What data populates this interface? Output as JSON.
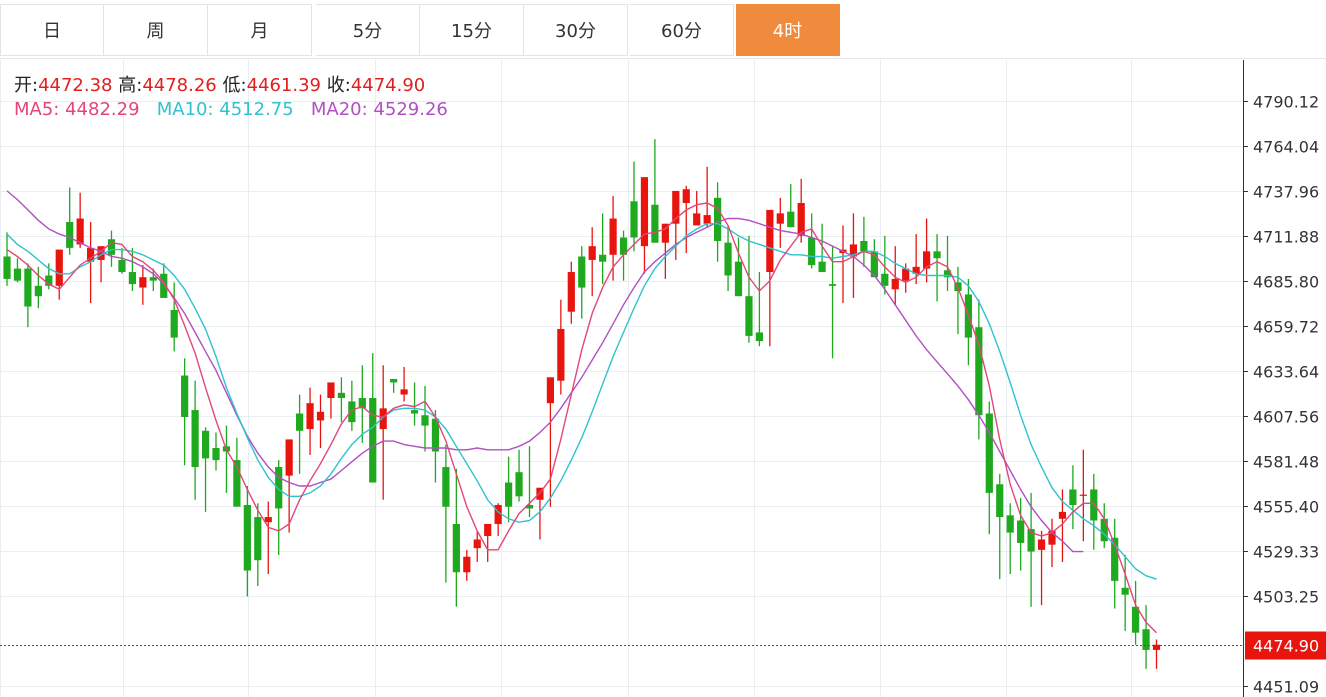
{
  "tabs": [
    {
      "label": "日",
      "active": false
    },
    {
      "label": "周",
      "active": false
    },
    {
      "label": "月",
      "active": false
    },
    {
      "label": "5分",
      "active": false
    },
    {
      "label": "15分",
      "active": false
    },
    {
      "label": "30分",
      "active": false
    },
    {
      "label": "60分",
      "active": false
    },
    {
      "label": "4时",
      "active": true
    }
  ],
  "ohlc_info": {
    "open_label": "开:",
    "open": "4472.38",
    "high_label": "高:",
    "high": "4478.26",
    "low_label": "低:",
    "low": "4461.39",
    "close_label": "收:",
    "close": "4474.90"
  },
  "ma_info": {
    "ma5_label": "MA5:",
    "ma5": "4482.29",
    "ma10_label": "MA10:",
    "ma10": "4512.75",
    "ma20_label": "MA20:",
    "ma20": "4529.26"
  },
  "colors": {
    "up": "#e8150f",
    "down": "#1ea91e",
    "ma5": "#e4467a",
    "ma10": "#2fc2cf",
    "ma20": "#b24fc4",
    "accent": "#f08a3c",
    "price_tag": "#e8150f"
  },
  "chart_data": {
    "type": "candlestick",
    "y_ticks": [
      "4790.12",
      "4764.04",
      "4737.96",
      "4711.88",
      "4685.80",
      "4659.72",
      "4633.64",
      "4607.56",
      "4581.48",
      "4555.40",
      "4529.33",
      "4503.25",
      "4451.09"
    ],
    "ylim": [
      4451.09,
      4790.12
    ],
    "current_price": "4474.90",
    "candles": [
      [
        4700,
        4714,
        4683,
        4687
      ],
      [
        4693,
        4699,
        4685,
        4686
      ],
      [
        4693,
        4696,
        4659,
        4671
      ],
      [
        4683,
        4694,
        4670,
        4677
      ],
      [
        4689,
        4696,
        4681,
        4683
      ],
      [
        4683,
        4693,
        4675,
        4704
      ],
      [
        4720,
        4740,
        4701,
        4705
      ],
      [
        4707,
        4737,
        4705,
        4722
      ],
      [
        4697,
        4720,
        4673,
        4705
      ],
      [
        4698,
        4705,
        4685,
        4706
      ],
      [
        4710,
        4715,
        4694,
        4701
      ],
      [
        4698,
        4705,
        4690,
        4691
      ],
      [
        4691,
        4705,
        4680,
        4684
      ],
      [
        4682,
        4695,
        4672,
        4688
      ],
      [
        4688,
        4693,
        4680,
        4686
      ],
      [
        4690,
        4696,
        4677,
        4676
      ],
      [
        4669,
        4685,
        4645,
        4653
      ],
      [
        4631,
        4641,
        4579,
        4607
      ],
      [
        4611,
        4628,
        4559,
        4578
      ],
      [
        4599,
        4601,
        4552,
        4583
      ],
      [
        4589,
        4598,
        4576,
        4582
      ],
      [
        4590,
        4602,
        4563,
        4587
      ],
      [
        4582,
        4595,
        4565,
        4555
      ],
      [
        4556,
        4567,
        4503,
        4518
      ],
      [
        4549,
        4557,
        4509,
        4524
      ],
      [
        4546,
        4558,
        4516,
        4549
      ],
      [
        4578,
        4582,
        4527,
        4554
      ],
      [
        4573,
        4582,
        4540,
        4594
      ],
      [
        4609,
        4620,
        4574,
        4599
      ],
      [
        4600,
        4624,
        4585,
        4615
      ],
      [
        4605,
        4620,
        4589,
        4610
      ],
      [
        4618,
        4626,
        4606,
        4627
      ],
      [
        4621,
        4630,
        4604,
        4618
      ],
      [
        4616,
        4628,
        4599,
        4604
      ],
      [
        4618,
        4637,
        4592,
        4612
      ],
      [
        4618,
        4644,
        4594,
        4569
      ],
      [
        4600,
        4637,
        4559,
        4612
      ],
      [
        4629,
        4627,
        4621,
        4627
      ],
      [
        4620,
        4636,
        4616,
        4623
      ],
      [
        4611,
        4627,
        4602,
        4609
      ],
      [
        4608,
        4625,
        4587,
        4602
      ],
      [
        4606,
        4611,
        4569,
        4587
      ],
      [
        4578,
        4591,
        4511,
        4555
      ],
      [
        4545,
        4577,
        4497,
        4517
      ],
      [
        4517,
        4530,
        4512,
        4526
      ],
      [
        4531,
        4541,
        4523,
        4536
      ],
      [
        4538,
        4544,
        4523,
        4545
      ],
      [
        4545,
        4557,
        4538,
        4556
      ],
      [
        4569,
        4584,
        4546,
        4555
      ],
      [
        4575,
        4588,
        4558,
        4561
      ],
      [
        4556,
        4590,
        4549,
        4554
      ],
      [
        4559,
        4565,
        4536,
        4566
      ],
      [
        4615,
        4618,
        4555,
        4630
      ],
      [
        4628,
        4675,
        4620,
        4658
      ],
      [
        4668,
        4697,
        4661,
        4691
      ],
      [
        4700,
        4706,
        4664,
        4682
      ],
      [
        4698,
        4717,
        4677,
        4706
      ],
      [
        4701,
        4725,
        4684,
        4697
      ],
      [
        4701,
        4735,
        4686,
        4722
      ],
      [
        4711,
        4715,
        4686,
        4701
      ],
      [
        4732,
        4755,
        4703,
        4711
      ],
      [
        4706,
        4741,
        4690,
        4746
      ],
      [
        4730,
        4768,
        4711,
        4708
      ],
      [
        4708,
        4719,
        4687,
        4719
      ],
      [
        4719,
        4737,
        4698,
        4738
      ],
      [
        4731,
        4741,
        4702,
        4739
      ],
      [
        4718,
        4738,
        4719,
        4725
      ],
      [
        4719,
        4752,
        4717,
        4724
      ],
      [
        4734,
        4743,
        4697,
        4709
      ],
      [
        4708,
        4718,
        4680,
        4689
      ],
      [
        4697,
        4711,
        4685,
        4677
      ],
      [
        4677,
        4712,
        4650,
        4654
      ],
      [
        4656,
        4691,
        4648,
        4651
      ],
      [
        4691,
        4718,
        4648,
        4727
      ],
      [
        4719,
        4734,
        4705,
        4725
      ],
      [
        4726,
        4742,
        4717,
        4717
      ],
      [
        4712,
        4745,
        4708,
        4731
      ],
      [
        4711,
        4725,
        4693,
        4695
      ],
      [
        4697,
        4719,
        4691,
        4691
      ],
      [
        4684,
        4706,
        4641,
        4683
      ],
      [
        4702,
        4718,
        4673,
        4704
      ],
      [
        4700,
        4725,
        4676,
        4707
      ],
      [
        4709,
        4723,
        4694,
        4703
      ],
      [
        4703,
        4710,
        4694,
        4688
      ],
      [
        4690,
        4712,
        4678,
        4683
      ],
      [
        4681,
        4706,
        4672,
        4687
      ],
      [
        4686,
        4696,
        4679,
        4693
      ],
      [
        4690,
        4713,
        4684,
        4694
      ],
      [
        4693,
        4722,
        4685,
        4703
      ],
      [
        4703,
        4713,
        4674,
        4699
      ],
      [
        4692,
        4712,
        4680,
        4688
      ],
      [
        4685,
        4694,
        4655,
        4680
      ],
      [
        4678,
        4687,
        4637,
        4653
      ],
      [
        4659,
        4675,
        4594,
        4608
      ],
      [
        4609,
        4616,
        4539,
        4563
      ],
      [
        4568,
        4574,
        4513,
        4549
      ],
      [
        4550,
        4557,
        4516,
        4540
      ],
      [
        4547,
        4560,
        4518,
        4534
      ],
      [
        4542,
        4563,
        4497,
        4529
      ],
      [
        4530,
        4541,
        4498,
        4536
      ],
      [
        4533,
        4548,
        4520,
        4541
      ],
      [
        4548,
        4565,
        4523,
        4552
      ],
      [
        4565,
        4579,
        4542,
        4556
      ],
      [
        4562,
        4588,
        4535,
        4562
      ],
      [
        4565,
        4574,
        4530,
        4547
      ],
      [
        4548,
        4557,
        4531,
        4535
      ],
      [
        4537,
        4548,
        4496,
        4512
      ],
      [
        4508,
        4527,
        4483,
        4504
      ],
      [
        4497,
        4512,
        4475,
        4482
      ],
      [
        4484,
        4498,
        4461,
        4472
      ],
      [
        4472,
        4478,
        4461,
        4475
      ]
    ],
    "ma5": [
      4704,
      4700,
      4695,
      4689,
      4684,
      4681,
      4688,
      4695,
      4699,
      4703,
      4708,
      4707,
      4700,
      4697,
      4692,
      4685,
      4675,
      4660,
      4644,
      4624,
      4605,
      4588,
      4578,
      4565,
      4553,
      4543,
      4541,
      4545,
      4559,
      4570,
      4580,
      4591,
      4603,
      4611,
      4613,
      4608,
      4607,
      4612,
      4614,
      4613,
      4616,
      4607,
      4593,
      4574,
      4555,
      4541,
      4530,
      4530,
      4541,
      4551,
      4557,
      4563,
      4571,
      4594,
      4620,
      4646,
      4667,
      4682,
      4694,
      4701,
      4707,
      4713,
      4714,
      4716,
      4722,
      4727,
      4730,
      4731,
      4728,
      4718,
      4702,
      4688,
      4680,
      4686,
      4698,
      4706,
      4714,
      4716,
      4706,
      4697,
      4697,
      4700,
      4703,
      4701,
      4694,
      4688,
      4685,
      4688,
      4694,
      4697,
      4694,
      4682,
      4666,
      4649,
      4625,
      4594,
      4568,
      4550,
      4540,
      4538,
      4540,
      4545,
      4552,
      4557,
      4557,
      4548,
      4533,
      4516,
      4498,
      4488,
      4482
    ],
    "ma10": [
      4713,
      4707,
      4703,
      4698,
      4693,
      4690,
      4690,
      4694,
      4697,
      4701,
      4704,
      4704,
      4703,
      4701,
      4698,
      4695,
      4689,
      4681,
      4670,
      4658,
      4642,
      4624,
      4609,
      4595,
      4582,
      4572,
      4565,
      4561,
      4561,
      4563,
      4567,
      4574,
      4583,
      4591,
      4597,
      4601,
      4607,
      4611,
      4612,
      4612,
      4611,
      4607,
      4600,
      4590,
      4580,
      4570,
      4559,
      4552,
      4548,
      4546,
      4547,
      4552,
      4560,
      4570,
      4582,
      4595,
      4610,
      4626,
      4642,
      4656,
      4670,
      4683,
      4693,
      4700,
      4706,
      4712,
      4716,
      4719,
      4719,
      4716,
      4712,
      4709,
      4707,
      4705,
      4703,
      4701,
      4701,
      4700,
      4700,
      4699,
      4700,
      4701,
      4703,
      4703,
      4700,
      4696,
      4693,
      4690,
      4689,
      4689,
      4689,
      4688,
      4683,
      4674,
      4661,
      4645,
      4627,
      4608,
      4591,
      4578,
      4566,
      4558,
      4553,
      4548,
      4544,
      4539,
      4533,
      4526,
      4519,
      4515,
      4513
    ],
    "ma20": [
      4738,
      4733,
      4727,
      4721,
      4716,
      4713,
      4711,
      4708,
      4705,
      4703,
      4700,
      4699,
      4697,
      4694,
      4690,
      4684,
      4676,
      4667,
      4656,
      4645,
      4634,
      4621,
      4608,
      4596,
      4586,
      4578,
      4572,
      4569,
      4567,
      4567,
      4569,
      4571,
      4576,
      4581,
      4586,
      4590,
      4593,
      4593,
      4591,
      4590,
      4589,
      4589,
      4589,
      4588,
      4588,
      4589,
      4588,
      4588,
      4588,
      4590,
      4593,
      4598,
      4604,
      4612,
      4621,
      4630,
      4640,
      4650,
      4661,
      4672,
      4682,
      4691,
      4697,
      4702,
      4707,
      4711,
      4714,
      4717,
      4720,
      4722,
      4722,
      4721,
      4719,
      4717,
      4715,
      4714,
      4713,
      4711,
      4709,
      4706,
      4703,
      4700,
      4695,
      4689,
      4681,
      4672,
      4663,
      4654,
      4646,
      4639,
      4632,
      4625,
      4617,
      4608,
      4598,
      4587,
      4576,
      4565,
      4555,
      4547,
      4540,
      4535,
      4529,
      4529
    ]
  }
}
